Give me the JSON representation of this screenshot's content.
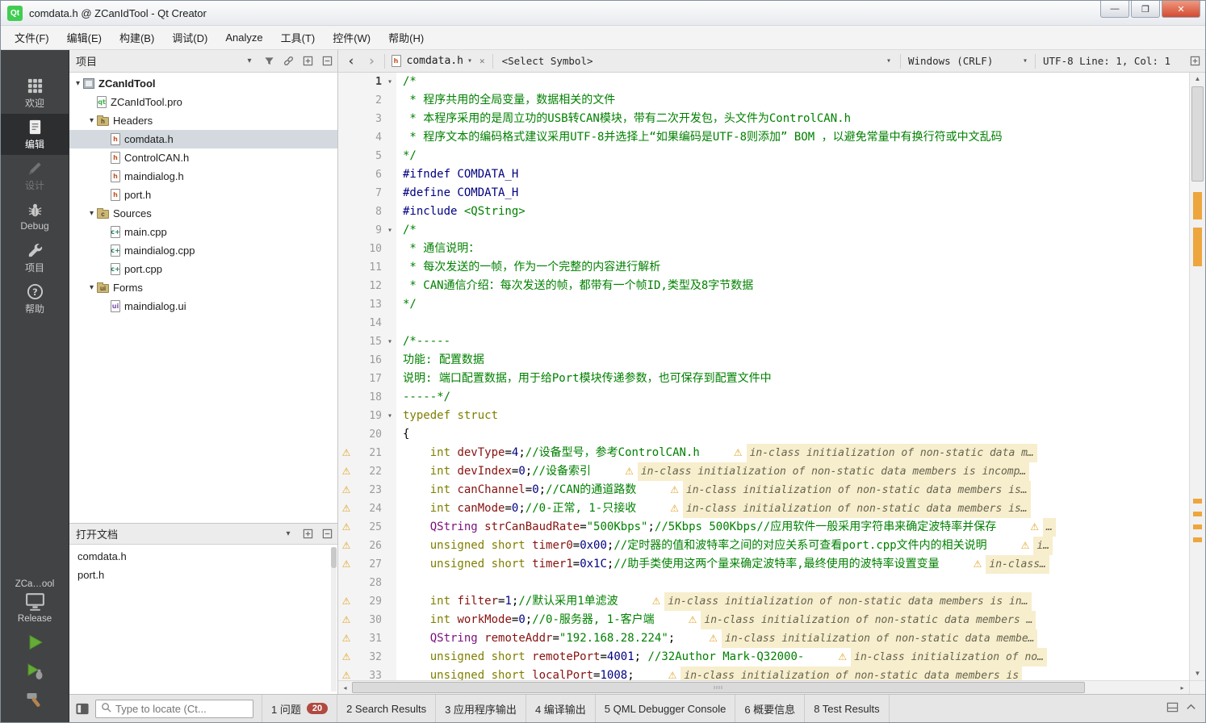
{
  "titlebar": {
    "app_badge": "Qt",
    "title": "comdata.h @ ZCanIdTool - Qt Creator",
    "controls": {
      "minimize": "—",
      "maximize": "❐",
      "close": "✕"
    }
  },
  "menubar": {
    "items": [
      "文件(F)",
      "编辑(E)",
      "构建(B)",
      "调试(D)",
      "Analyze",
      "工具(T)",
      "控件(W)",
      "帮助(H)"
    ]
  },
  "mode_sidebar": {
    "modes": [
      {
        "label": "欢迎",
        "icon": "welcome-grid-icon",
        "selected": false,
        "disabled": false
      },
      {
        "label": "编辑",
        "icon": "edit-document-icon",
        "selected": true,
        "disabled": false
      },
      {
        "label": "设计",
        "icon": "design-pen-icon",
        "selected": false,
        "disabled": true
      },
      {
        "label": "Debug",
        "icon": "debug-bug-icon",
        "selected": false,
        "disabled": false
      },
      {
        "label": "项目",
        "icon": "project-wrench-icon",
        "selected": false,
        "disabled": false
      },
      {
        "label": "帮助",
        "icon": "help-question-icon",
        "selected": false,
        "disabled": false
      }
    ],
    "kit_selector": {
      "kit_name": "ZCa…ool",
      "build_config": "Release"
    }
  },
  "project_panel": {
    "header": "项目",
    "tree": [
      {
        "label": "ZCanIdTool",
        "depth": 0,
        "icon": "project-icon",
        "expanded": true,
        "bold": true
      },
      {
        "label": "ZCanIdTool.pro",
        "depth": 1,
        "icon": "pro-file-icon"
      },
      {
        "label": "Headers",
        "depth": 1,
        "icon": "headers-folder-icon",
        "expanded": true
      },
      {
        "label": "comdata.h",
        "depth": 2,
        "icon": "h-file-icon",
        "selected": true
      },
      {
        "label": "ControlCAN.h",
        "depth": 2,
        "icon": "h-file-icon"
      },
      {
        "label": "maindialog.h",
        "depth": 2,
        "icon": "h-file-icon"
      },
      {
        "label": "port.h",
        "depth": 2,
        "icon": "h-file-icon"
      },
      {
        "label": "Sources",
        "depth": 1,
        "icon": "sources-folder-icon",
        "expanded": true
      },
      {
        "label": "main.cpp",
        "depth": 2,
        "icon": "cpp-file-icon"
      },
      {
        "label": "maindialog.cpp",
        "depth": 2,
        "icon": "cpp-file-icon"
      },
      {
        "label": "port.cpp",
        "depth": 2,
        "icon": "cpp-file-icon"
      },
      {
        "label": "Forms",
        "depth": 1,
        "icon": "forms-folder-icon",
        "expanded": true
      },
      {
        "label": "maindialog.ui",
        "depth": 2,
        "icon": "ui-file-icon"
      }
    ]
  },
  "open_documents": {
    "header": "打开文档",
    "items": [
      "comdata.h",
      "port.h"
    ]
  },
  "editor": {
    "nav_back": "‹",
    "nav_forward": "›",
    "tab_label": "comdata.h",
    "symbol_selector": "<Select Symbol>",
    "line_ending": "Windows (CRLF)",
    "cursor_info": "UTF-8 Line: 1, Col: 1",
    "lines": [
      {
        "n": 1,
        "fold": true,
        "seg": [
          [
            "/*",
            "cmt"
          ]
        ]
      },
      {
        "n": 2,
        "seg": [
          [
            " * 程序共用的全局变量，数据相关的文件",
            "cmt"
          ]
        ]
      },
      {
        "n": 3,
        "seg": [
          [
            " * 本程序采用的是周立功的USB转CAN模块，带有二次开发包，头文件为ControlCAN.h",
            "cmt"
          ]
        ]
      },
      {
        "n": 4,
        "seg": [
          [
            " * 程序文本的编码格式建议采用UTF-8并选择上“如果编码是UTF-8则添加” BOM ，以避免常量中有换行符或中文乱码",
            "cmt"
          ]
        ]
      },
      {
        "n": 5,
        "seg": [
          [
            "*/",
            "cmt"
          ]
        ]
      },
      {
        "n": 6,
        "seg": [
          [
            "#ifndef COMDATA_H",
            "pre"
          ]
        ]
      },
      {
        "n": 7,
        "seg": [
          [
            "#define COMDATA_H",
            "pre"
          ]
        ]
      },
      {
        "n": 8,
        "seg": [
          [
            "#include ",
            "pre"
          ],
          [
            "<QString>",
            "str"
          ]
        ]
      },
      {
        "n": 9,
        "fold": true,
        "seg": [
          [
            "/*",
            "cmt"
          ]
        ]
      },
      {
        "n": 10,
        "seg": [
          [
            " * 通信说明：",
            "cmt"
          ]
        ]
      },
      {
        "n": 11,
        "seg": [
          [
            " * 每次发送的一帧，作为一个完整的内容进行解析",
            "cmt"
          ]
        ]
      },
      {
        "n": 12,
        "seg": [
          [
            " * CAN通信介绍：每次发送的帧，都带有一个帧ID,类型及8字节数据",
            "cmt"
          ]
        ]
      },
      {
        "n": 13,
        "seg": [
          [
            "*/",
            "cmt"
          ]
        ]
      },
      {
        "n": 14,
        "seg": []
      },
      {
        "n": 15,
        "fold": true,
        "seg": [
          [
            "/*-----",
            "cmt"
          ]
        ]
      },
      {
        "n": 16,
        "seg": [
          [
            "功能: 配置数据",
            "cmt"
          ]
        ]
      },
      {
        "n": 17,
        "seg": [
          [
            "说明: 端口配置数据，用于给Port模块传递参数，也可保存到配置文件中",
            "cmt"
          ]
        ]
      },
      {
        "n": 18,
        "seg": [
          [
            "-----*/",
            "cmt"
          ]
        ]
      },
      {
        "n": 19,
        "fold": true,
        "seg": [
          [
            "typedef",
            "kw"
          ],
          [
            " ",
            "pln"
          ],
          [
            "struct",
            "kw"
          ]
        ]
      },
      {
        "n": 20,
        "seg": [
          [
            "{",
            "pln"
          ]
        ]
      },
      {
        "n": 21,
        "warn": true,
        "seg": [
          [
            "    ",
            "pln"
          ],
          [
            "int",
            "kw"
          ],
          [
            " ",
            "pln"
          ],
          [
            "devType",
            "mem"
          ],
          [
            "=",
            "pln"
          ],
          [
            "4",
            "num"
          ],
          [
            ";",
            "pln"
          ],
          [
            "//设备型号，参考ControlCAN.h",
            "cmt"
          ]
        ],
        "ann": "in-class initialization of non-static data m…"
      },
      {
        "n": 22,
        "warn": true,
        "seg": [
          [
            "    ",
            "pln"
          ],
          [
            "int",
            "kw"
          ],
          [
            " ",
            "pln"
          ],
          [
            "devIndex",
            "mem"
          ],
          [
            "=",
            "pln"
          ],
          [
            "0",
            "num"
          ],
          [
            ";",
            "pln"
          ],
          [
            "//设备索引",
            "cmt"
          ]
        ],
        "ann": "in-class initialization of non-static data members is incomp…"
      },
      {
        "n": 23,
        "warn": true,
        "seg": [
          [
            "    ",
            "pln"
          ],
          [
            "int",
            "kw"
          ],
          [
            " ",
            "pln"
          ],
          [
            "canChannel",
            "mem"
          ],
          [
            "=",
            "pln"
          ],
          [
            "0",
            "num"
          ],
          [
            ";",
            "pln"
          ],
          [
            "//CAN的通道路数",
            "cmt"
          ]
        ],
        "ann": "in-class initialization of non-static data members is…"
      },
      {
        "n": 24,
        "warn": true,
        "seg": [
          [
            "    ",
            "pln"
          ],
          [
            "int",
            "kw"
          ],
          [
            " ",
            "pln"
          ],
          [
            "canMode",
            "mem"
          ],
          [
            "=",
            "pln"
          ],
          [
            "0",
            "num"
          ],
          [
            ";",
            "pln"
          ],
          [
            "//0-正常, 1-只接收",
            "cmt"
          ]
        ],
        "ann": "in-class initialization of non-static data members is…"
      },
      {
        "n": 25,
        "warn": true,
        "seg": [
          [
            "    ",
            "pln"
          ],
          [
            "QString",
            "typ"
          ],
          [
            " ",
            "pln"
          ],
          [
            "strCanBaudRate",
            "mem"
          ],
          [
            "=",
            "pln"
          ],
          [
            "\"500Kbps\"",
            "str"
          ],
          [
            ";",
            "pln"
          ],
          [
            "//5Kbps 500Kbps//应用软件一般采用字符串来确定波特率并保存",
            "cmt"
          ]
        ],
        "ann": "…"
      },
      {
        "n": 26,
        "warn": true,
        "seg": [
          [
            "    ",
            "pln"
          ],
          [
            "unsigned short",
            "kw"
          ],
          [
            " ",
            "pln"
          ],
          [
            "timer0",
            "mem"
          ],
          [
            "=",
            "pln"
          ],
          [
            "0x00",
            "num"
          ],
          [
            ";",
            "pln"
          ],
          [
            "//定时器的值和波特率之间的对应关系可查看port.cpp文件内的相关说明",
            "cmt"
          ]
        ],
        "ann": "i…"
      },
      {
        "n": 27,
        "warn": true,
        "seg": [
          [
            "    ",
            "pln"
          ],
          [
            "unsigned short",
            "kw"
          ],
          [
            " ",
            "pln"
          ],
          [
            "timer1",
            "mem"
          ],
          [
            "=",
            "pln"
          ],
          [
            "0x1C",
            "num"
          ],
          [
            ";",
            "pln"
          ],
          [
            "//助手类使用这两个量来确定波特率,最终使用的波特率设置变量",
            "cmt"
          ]
        ],
        "ann": "in-class…"
      },
      {
        "n": 28,
        "seg": []
      },
      {
        "n": 29,
        "warn": true,
        "seg": [
          [
            "    ",
            "pln"
          ],
          [
            "int",
            "kw"
          ],
          [
            " ",
            "pln"
          ],
          [
            "filter",
            "mem"
          ],
          [
            "=",
            "pln"
          ],
          [
            "1",
            "num"
          ],
          [
            ";",
            "pln"
          ],
          [
            "//默认采用1单滤波",
            "cmt"
          ]
        ],
        "ann": "in-class initialization of non-static data members is in…"
      },
      {
        "n": 30,
        "warn": true,
        "seg": [
          [
            "    ",
            "pln"
          ],
          [
            "int",
            "kw"
          ],
          [
            " ",
            "pln"
          ],
          [
            "workMode",
            "mem"
          ],
          [
            "=",
            "pln"
          ],
          [
            "0",
            "num"
          ],
          [
            ";",
            "pln"
          ],
          [
            "//0-服务器, 1-客户端",
            "cmt"
          ]
        ],
        "ann": "in-class initialization of non-static data members …"
      },
      {
        "n": 31,
        "warn": true,
        "seg": [
          [
            "    ",
            "pln"
          ],
          [
            "QString",
            "typ"
          ],
          [
            " ",
            "pln"
          ],
          [
            "remoteAddr",
            "mem"
          ],
          [
            "=",
            "pln"
          ],
          [
            "\"192.168.28.224\"",
            "str"
          ],
          [
            ";",
            "pln"
          ]
        ],
        "ann": "in-class initialization of non-static data membe…"
      },
      {
        "n": 32,
        "warn": true,
        "seg": [
          [
            "    ",
            "pln"
          ],
          [
            "unsigned short",
            "kw"
          ],
          [
            " ",
            "pln"
          ],
          [
            "remotePort",
            "mem"
          ],
          [
            "=",
            "pln"
          ],
          [
            "4001",
            "num"
          ],
          [
            "; ",
            "pln"
          ],
          [
            "//32Author Mark-Q32000-",
            "cmt"
          ]
        ],
        "ann": "in-class initialization of no…"
      },
      {
        "n": 33,
        "warn": true,
        "seg": [
          [
            "    ",
            "pln"
          ],
          [
            "unsigned short",
            "kw"
          ],
          [
            " ",
            "pln"
          ],
          [
            "localPort",
            "mem"
          ],
          [
            "=",
            "pln"
          ],
          [
            "1008",
            "num"
          ],
          [
            ";",
            "pln"
          ]
        ],
        "ann": "in-class initialization of non-static data members is"
      }
    ]
  },
  "status_bar": {
    "locator_placeholder": "Type to locate (Ct...",
    "panel_buttons": [
      {
        "label": "1 问题",
        "badge": "20"
      },
      {
        "label": "2 Search Results"
      },
      {
        "label": "3 应用程序输出"
      },
      {
        "label": "4 编译输出"
      },
      {
        "label": "5 QML Debugger Console"
      },
      {
        "label": "6 概要信息"
      },
      {
        "label": "8 Test Results"
      }
    ]
  }
}
